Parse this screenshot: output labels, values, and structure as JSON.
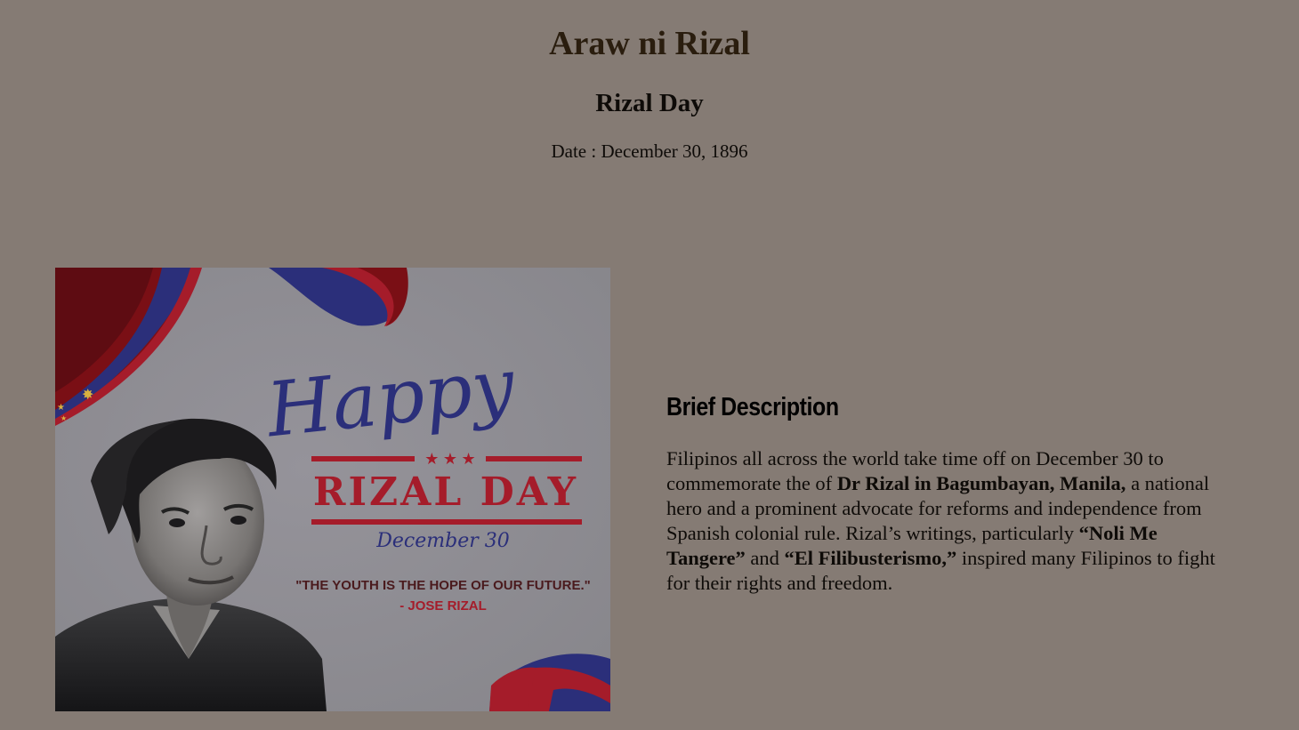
{
  "header": {
    "title": "Araw ni Rizal",
    "subtitle": "Rizal Day",
    "date_label": "Date",
    "date_value": "December 30, 1896"
  },
  "poster": {
    "happy": "Happy",
    "rizal_day": "RIZAL DAY",
    "date": "December 30",
    "quote": "\"THE YOUTH IS THE HOPE OF OUR FUTURE.\"",
    "author": "- JOSE RIZAL",
    "colors": {
      "blue": "#2b2f7a",
      "red": "#a51c2a",
      "background": "#8c8a8b"
    }
  },
  "description": {
    "heading": "Brief Description",
    "segments": [
      {
        "text": "Filipinos all across the world take time off on December 30 to commemorate the of ",
        "bold": false
      },
      {
        "text": "Dr Rizal in Bagumbayan, Manila,",
        "bold": true
      },
      {
        "text": " a national hero and a prominent advocate for reforms and independence from Spanish colonial rule. Rizal’s writings, particularly ",
        "bold": false
      },
      {
        "text": "“Noli Me Tangere”",
        "bold": true
      },
      {
        "text": " and ",
        "bold": false
      },
      {
        "text": "“El Filibusterismo,”",
        "bold": true
      },
      {
        "text": " inspired many Filipinos to fight for their rights and freedom.",
        "bold": false
      }
    ]
  }
}
